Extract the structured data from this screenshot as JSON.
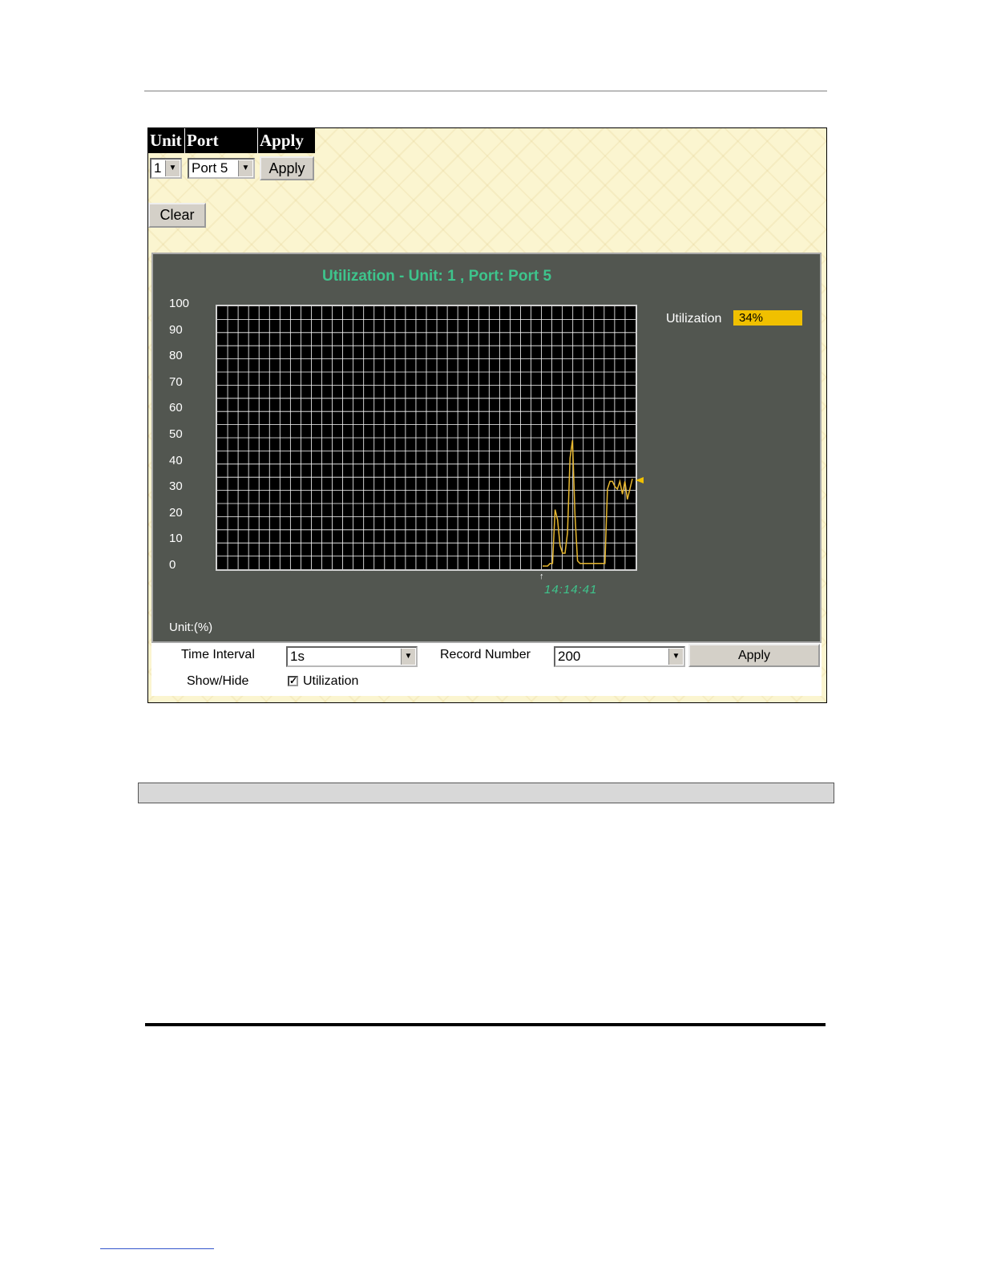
{
  "header": {
    "unit_label": "Unit",
    "port_label": "Port",
    "apply_label": "Apply"
  },
  "unit_select": {
    "value": "1"
  },
  "port_select": {
    "value": "Port 5"
  },
  "apply_button": "Apply",
  "clear_button": "Clear",
  "graph": {
    "title": "Utilization - Unit: 1 , Port: Port 5",
    "unit_label": "Unit:(%)",
    "time_label": "14:14:41",
    "legend": {
      "label": "Utilization",
      "value": "34%"
    }
  },
  "controls": {
    "time_interval_label": "Time Interval",
    "time_interval_value": "1s",
    "record_number_label": "Record Number",
    "record_number_value": "200",
    "apply_label": "Apply",
    "show_hide_label": "Show/Hide",
    "utilization_checkbox_label": "Utilization",
    "utilization_checked": true
  },
  "colors": {
    "series": "#e8b830",
    "title": "#3ec48c",
    "legend_bg": "#f0c000",
    "panel_bg": "#525650"
  },
  "chart_data": {
    "type": "line",
    "ylabel": "Unit:(%)",
    "ylim": [
      0,
      100
    ],
    "yticks": [
      "100",
      "90",
      "80",
      "70",
      "60",
      "50",
      "40",
      "30",
      "20",
      "10",
      "0"
    ],
    "grid": true,
    "series": [
      {
        "name": "Utilization",
        "values": [
          0,
          0,
          0,
          1,
          1,
          22,
          18,
          8,
          5,
          5,
          13,
          42,
          49,
          20,
          2,
          1,
          1,
          1,
          1,
          1,
          1,
          1,
          1,
          1,
          1,
          1,
          30,
          33,
          33,
          31,
          30,
          33,
          28,
          33,
          26,
          30,
          34
        ]
      }
    ]
  }
}
